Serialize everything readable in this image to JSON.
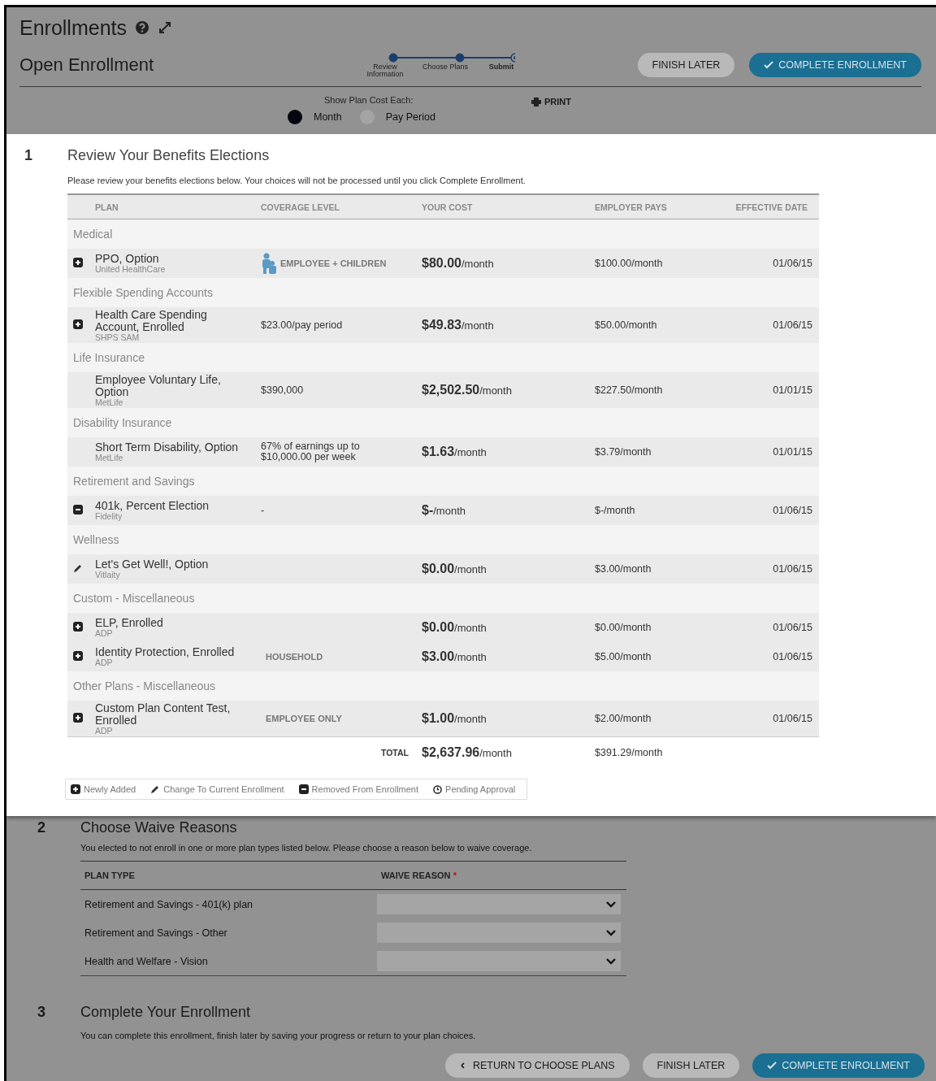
{
  "header": {
    "title": "Enrollments",
    "subtitle": "Open Enrollment"
  },
  "steps": [
    {
      "label": "Review Information",
      "selected": false
    },
    {
      "label": "Choose Plans",
      "selected": false
    },
    {
      "label": "Submit",
      "selected": true
    }
  ],
  "header_buttons": [
    {
      "label": "FINISH LATER",
      "kind": "secondary"
    },
    {
      "label": "COMPLETE ENROLLMENT",
      "kind": "primary"
    }
  ],
  "cost_toggle": {
    "label": "Show Plan Cost Each:",
    "options": [
      {
        "label": "Month",
        "selected": true
      },
      {
        "label": "Pay Period",
        "selected": false
      }
    ]
  },
  "print": "PRINT",
  "section1": {
    "number": "1",
    "title": "Review Your Benefits Elections",
    "description": "Please review your benefits elections below. Your choices will not be processed until you click Complete Enrollment.",
    "columns": [
      "PLAN",
      "COVERAGE LEVEL",
      "YOUR COST",
      "EMPLOYER PAYS",
      "EFFECTIVE DATE"
    ],
    "groups": [
      {
        "name": "Medical",
        "rows": [
          {
            "kind": "added",
            "plan": "PPO, Option",
            "carrier": "United HealthCare",
            "coverage": {
              "text": "EMPLOYEE + CHILDREN",
              "kind": "tier"
            },
            "family_icon": true,
            "cost": "$80.00",
            "cost_unit": "/month",
            "employer": "$100.00/month",
            "date": "01/06/15"
          }
        ]
      },
      {
        "name": "Flexible Spending Accounts",
        "rows": [
          {
            "kind": "added",
            "plan": "Health Care Spending Account, Enrolled",
            "carrier": "SHPS SAM",
            "coverage": {
              "text": "$23.00/pay period",
              "kind": "amount"
            },
            "cost": "$49.83",
            "cost_unit": "/month",
            "employer": "$50.00/month",
            "date": "01/06/15"
          }
        ]
      },
      {
        "name": "Life Insurance",
        "rows": [
          {
            "plan": "Employee Voluntary Life, Option",
            "carrier": "MetLife",
            "coverage": {
              "text": "$390,000",
              "kind": "amount"
            },
            "cost": "$2,502.50",
            "cost_unit": "/month",
            "employer": "$227.50/month",
            "date": "01/01/15"
          }
        ]
      },
      {
        "name": "Disability Insurance",
        "rows": [
          {
            "plan": "Short Term Disability, Option",
            "carrier": "MetLife",
            "coverage": {
              "text": "67% of earnings up to $10,000.00 per week",
              "kind": "amount"
            },
            "cost": "$1.63",
            "cost_unit": "/month",
            "employer": "$3.79/month",
            "date": "01/01/15"
          }
        ]
      },
      {
        "name": "Retirement and Savings",
        "rows": [
          {
            "kind": "removed",
            "plan": "401k, Percent Election",
            "carrier": "Fidelity",
            "coverage": {
              "text": "-",
              "kind": "amount"
            },
            "cost": "$-",
            "cost_unit": "/month",
            "employer": "$-/month",
            "date": "01/06/15"
          }
        ]
      },
      {
        "name": "Wellness",
        "rows": [
          {
            "kind": "changed",
            "plan": "Let's Get Well!, Option",
            "carrier": "Vitlaity",
            "cost": "$0.00",
            "cost_unit": "/month",
            "employer": "$3.00/month",
            "date": "01/06/15"
          }
        ]
      },
      {
        "name": "Custom - Miscellaneous",
        "rows": [
          {
            "kind": "added",
            "plan": "ELP, Enrolled",
            "carrier": "ADP",
            "cost": "$0.00",
            "cost_unit": "/month",
            "employer": "$0.00/month",
            "date": "01/06/15"
          },
          {
            "kind": "added",
            "plan": "Identity Protection, Enrolled",
            "carrier": "ADP",
            "coverage": {
              "text": "HOUSEHOLD",
              "kind": "tier"
            },
            "cost": "$3.00",
            "cost_unit": "/month",
            "employer": "$5.00/month",
            "date": "01/06/15"
          }
        ]
      },
      {
        "name": "Other Plans - Miscellaneous",
        "rows": [
          {
            "kind": "added",
            "plan": "Custom Plan Content Test, Enrolled",
            "carrier": "ADP",
            "coverage": {
              "text": "EMPLOYEE ONLY",
              "kind": "tier"
            },
            "cost": "$1.00",
            "cost_unit": "/month",
            "employer": "$2.00/month",
            "date": "01/06/15"
          }
        ]
      }
    ],
    "total": {
      "label": "TOTAL",
      "cost": "$2,637.96",
      "cost_unit": "/month",
      "employer": "$391.29/month"
    },
    "legend": [
      {
        "kind": "added",
        "label": "Newly Added"
      },
      {
        "kind": "changed",
        "label": "Change To Current Enrollment"
      },
      {
        "kind": "removed",
        "label": "Removed From Enrollment"
      },
      {
        "kind": "pending",
        "label": "Pending Approval"
      }
    ]
  },
  "section2": {
    "number": "2",
    "title": "Choose Waive Reasons",
    "description": "You elected to not enroll in one or more plan types listed below. Please choose a reason below to waive coverage.",
    "columns": [
      "PLAN TYPE",
      "WAIVE REASON"
    ],
    "required_mark": "*",
    "rows": [
      {
        "plan_type": "Retirement and Savings - 401(k) plan"
      },
      {
        "plan_type": "Retirement and Savings - Other"
      },
      {
        "plan_type": "Health and Welfare - Vision"
      }
    ]
  },
  "section3": {
    "number": "3",
    "title": "Complete Your Enrollment",
    "description": "You can complete this enrollment, finish later by saving your progress or return to your plan choices.",
    "buttons": [
      {
        "label": "RETURN TO CHOOSE PLANS",
        "kind": "back"
      },
      {
        "label": "FINISH LATER",
        "kind": "secondary"
      },
      {
        "label": "COMPLETE ENROLLMENT",
        "kind": "primary"
      }
    ]
  }
}
